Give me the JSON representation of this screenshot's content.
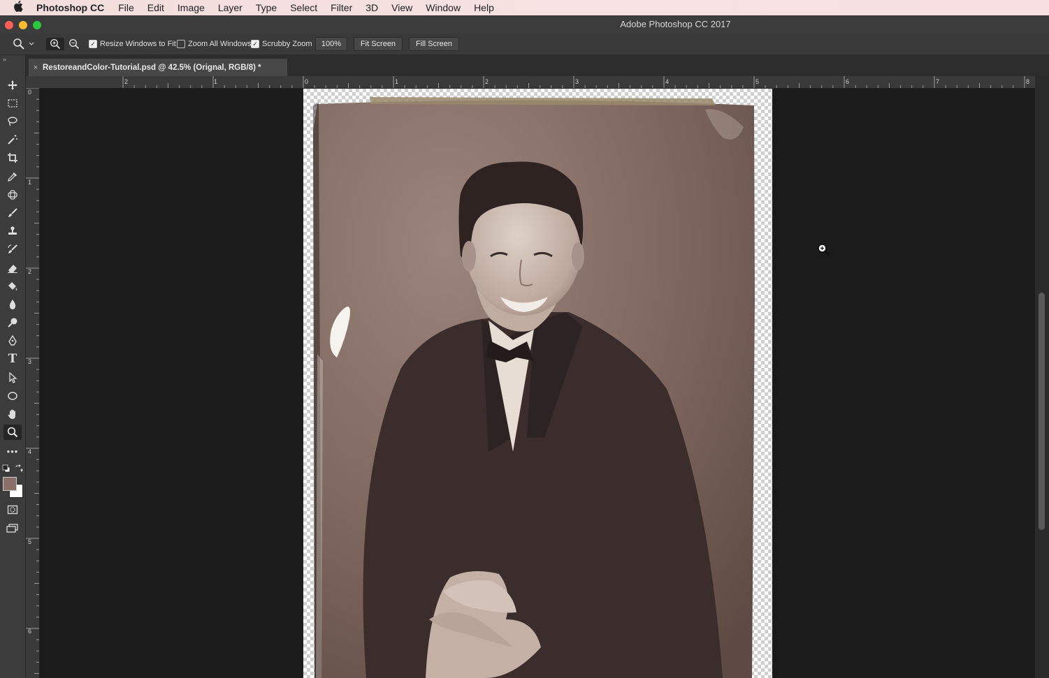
{
  "menubar": {
    "apple_icon": "apple-icon",
    "app_name": "Photoshop CC",
    "items": [
      "File",
      "Edit",
      "Image",
      "Layer",
      "Type",
      "Select",
      "Filter",
      "3D",
      "View",
      "Window",
      "Help"
    ]
  },
  "window": {
    "title": "Adobe Photoshop CC 2017",
    "light_colors": [
      "#fc5f57",
      "#fdbc2e",
      "#28c840"
    ]
  },
  "options": {
    "resize_windows_label": "Resize Windows to Fit",
    "resize_windows_checked": true,
    "zoom_all_label": "Zoom All Windows",
    "zoom_all_checked": false,
    "scrubby_zoom_label": "Scrubby Zoom",
    "scrubby_zoom_checked": true,
    "zoom_value": "100%",
    "fit_screen_label": "Fit Screen",
    "fill_screen_label": "Fill Screen"
  },
  "document": {
    "tab_title": "RestoreandColor-Tutorial.psd @ 42.5% (Orignal, RGB/8) *",
    "close_glyph": "×"
  },
  "rulers": {
    "horizontal_labels": [
      "2",
      "1",
      "0",
      "1",
      "2",
      "3",
      "4",
      "5",
      "6",
      "7",
      "8"
    ],
    "vertical_labels": [
      "0",
      "1",
      "2",
      "3",
      "4",
      "5",
      "6"
    ]
  },
  "tools": [
    "move-icon",
    "marquee-icon",
    "lasso-icon",
    "magic-wand-icon",
    "crop-icon",
    "eyedropper-icon",
    "healing-icon",
    "brush-icon",
    "stamp-icon",
    "history-brush-icon",
    "eraser-icon",
    "paint-bucket-icon",
    "blur-icon",
    "dodge-icon",
    "pen-icon",
    "type-icon",
    "path-select-icon",
    "ellipse-icon",
    "hand-icon",
    "zoom-icon",
    "more-icon"
  ],
  "colors": {
    "foreground": "#8a7068",
    "background": "#ffffff",
    "accent": "#1b1b1b"
  }
}
